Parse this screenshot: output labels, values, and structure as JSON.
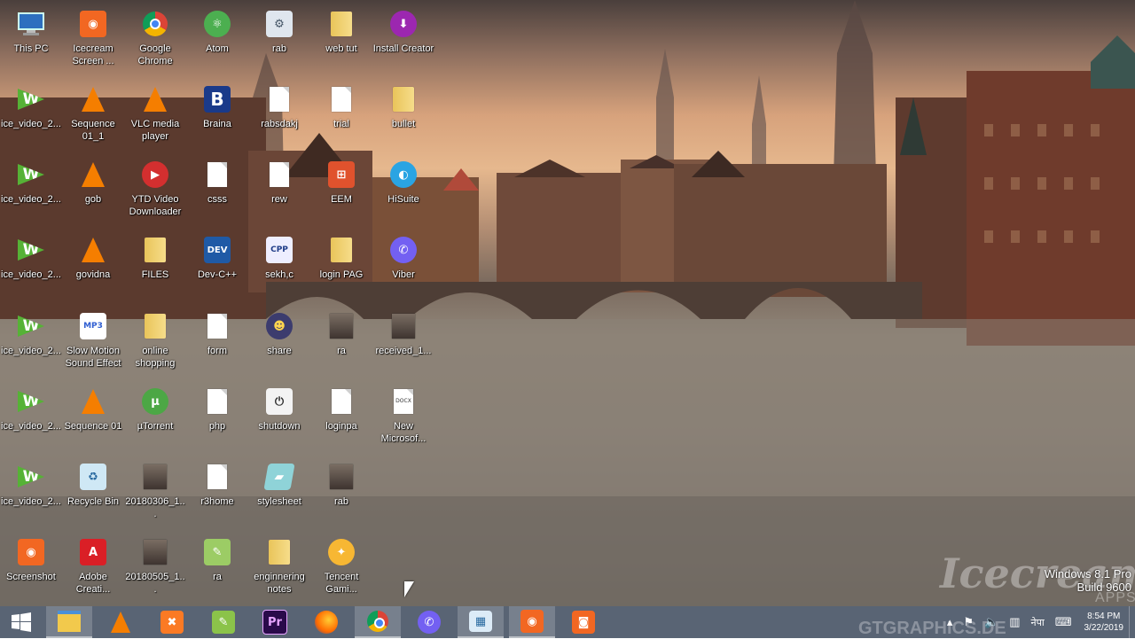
{
  "desktop": {
    "icons": [
      {
        "label": "This PC",
        "type": "pc"
      },
      {
        "label": "Icecream Screen ...",
        "type": "icecream"
      },
      {
        "label": "Google Chrome",
        "type": "chrome"
      },
      {
        "label": "Atom",
        "type": "atom"
      },
      {
        "label": "rab",
        "type": "settings-doc"
      },
      {
        "label": "web tut",
        "type": "folder"
      },
      {
        "label": "Install Creator",
        "type": "install"
      },
      {
        "label": "ice_video_2...",
        "type": "ice"
      },
      {
        "label": "Sequence 01_1",
        "type": "vlc"
      },
      {
        "label": "VLC media player",
        "type": "vlc"
      },
      {
        "label": "Braina",
        "type": "braina"
      },
      {
        "label": "rabsdakj",
        "type": "doc"
      },
      {
        "label": "trial",
        "type": "doc"
      },
      {
        "label": "bullet",
        "type": "folder"
      },
      {
        "label": "ice_video_2...",
        "type": "ice"
      },
      {
        "label": "gob",
        "type": "vlc"
      },
      {
        "label": "YTD Video Downloader",
        "type": "ytd"
      },
      {
        "label": "csss",
        "type": "doc"
      },
      {
        "label": "rew",
        "type": "doc"
      },
      {
        "label": "EEM",
        "type": "eem"
      },
      {
        "label": "HiSuite",
        "type": "hisuite"
      },
      {
        "label": "ice_video_2...",
        "type": "ice"
      },
      {
        "label": "govidna",
        "type": "vlc"
      },
      {
        "label": "FILES",
        "type": "folder"
      },
      {
        "label": "Dev-C++",
        "type": "dev"
      },
      {
        "label": "sekh,c",
        "type": "cpp"
      },
      {
        "label": "login PAG",
        "type": "folder"
      },
      {
        "label": "Viber",
        "type": "viber"
      },
      {
        "label": "ice_video_2...",
        "type": "ice"
      },
      {
        "label": "Slow Motion Sound Effect",
        "type": "mp3"
      },
      {
        "label": "online shopping",
        "type": "folder"
      },
      {
        "label": "form",
        "type": "doc"
      },
      {
        "label": "share",
        "type": "share"
      },
      {
        "label": "ra",
        "type": "photo"
      },
      {
        "label": "received_1...",
        "type": "photo"
      },
      {
        "label": "ice_video_2...",
        "type": "ice"
      },
      {
        "label": "Sequence 01",
        "type": "vlc"
      },
      {
        "label": "µTorrent",
        "type": "utorrent"
      },
      {
        "label": "php",
        "type": "doc"
      },
      {
        "label": "shutdown",
        "type": "shortcut"
      },
      {
        "label": "loginpa",
        "type": "doc"
      },
      {
        "label": "New Microsof...",
        "type": "docx"
      },
      {
        "label": "ice_video_2...",
        "type": "ice"
      },
      {
        "label": "Recycle Bin",
        "type": "recycle"
      },
      {
        "label": "20180306_1...",
        "type": "photo"
      },
      {
        "label": "r3home",
        "type": "doc"
      },
      {
        "label": "stylesheet",
        "type": "css"
      },
      {
        "label": "rab",
        "type": "photo"
      },
      {
        "label": "Screenshot",
        "type": "icecream"
      },
      {
        "label": "Adobe Creati...",
        "type": "adobe"
      },
      {
        "label": "20180505_1...",
        "type": "photo"
      },
      {
        "label": "ra",
        "type": "notepad"
      },
      {
        "label": "enginnering notes",
        "type": "folder"
      },
      {
        "label": "Tencent Gami...",
        "type": "tencent"
      }
    ]
  },
  "watermark": {
    "brand": "Icecream",
    "sub": "APPS",
    "site": "GTGRAPHICS.DE"
  },
  "os_version": {
    "line1": "Windows 8.1 Pro",
    "line2": "Build 9600"
  },
  "taskbar": {
    "apps": [
      {
        "name": "file-explorer",
        "active": true
      },
      {
        "name": "vlc",
        "active": false
      },
      {
        "name": "xampp",
        "active": false
      },
      {
        "name": "notepad-plus",
        "active": false
      },
      {
        "name": "premiere-pro",
        "active": false
      },
      {
        "name": "firefox",
        "active": false
      },
      {
        "name": "google-chrome",
        "active": true
      },
      {
        "name": "viber",
        "active": false
      },
      {
        "name": "paint",
        "active": true
      },
      {
        "name": "icecream-screen-recorder",
        "active": true
      },
      {
        "name": "icecream-screenshot",
        "active": false
      }
    ],
    "language": "नेपा",
    "time": "8:54 PM",
    "date": "3/22/2019"
  },
  "colors": {
    "taskbar": "#4b5768",
    "vlc": "#f57e00",
    "ice": "#56b236",
    "premiere": "#2a0a4a",
    "viber": "#7360f2"
  }
}
